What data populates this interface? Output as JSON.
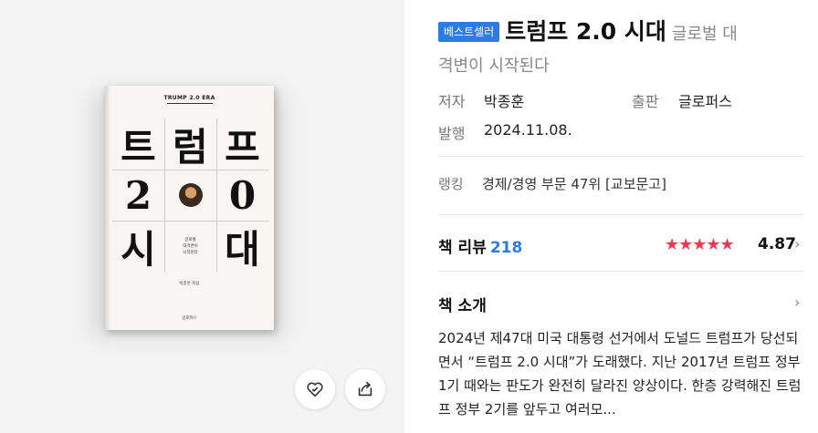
{
  "cover": {
    "series": "TRUMP 2.0 ERA",
    "grid_chars": [
      "트",
      "럼",
      "프",
      "2",
      "",
      "0",
      "시",
      "",
      "대"
    ],
    "center_text": "글로벌\n대격변이\n시작된다",
    "author_tag": "박종훈 지음",
    "publisher_tag": "글로퍼스"
  },
  "actions": {
    "like_icon": "heart-icon",
    "share_icon": "share-icon"
  },
  "header": {
    "badge": "베스트셀러",
    "title": "트럼프 2.0 시대",
    "subtitle_part1": "글로벌 대",
    "subtitle_part2": "격변이 시작된다"
  },
  "meta": {
    "author_label": "저자",
    "author": "박종훈",
    "publisher_label": "출판",
    "publisher": "글로퍼스",
    "date_label": "발행",
    "date": "2024.11.08."
  },
  "ranking": {
    "label": "랭킹",
    "value": "경제/경영 부문 47위 [교보문고]"
  },
  "review": {
    "title": "책 리뷰",
    "count": "218",
    "stars": "★★★★★",
    "rating": "4.87"
  },
  "intro": {
    "title": "책 소개",
    "body": "2024년 제47대 미국 대통령 선거에서 도널드 트럼프가 당선되면서 “트럼프 2.0 시대”가 도래했다. 지난 2017년 트럼프 정부 1기 때와는 판도가 완전히 달라진 양상이다. 한층 강력해진 트럼프 정부 2기를 앞두고 여러모..."
  }
}
